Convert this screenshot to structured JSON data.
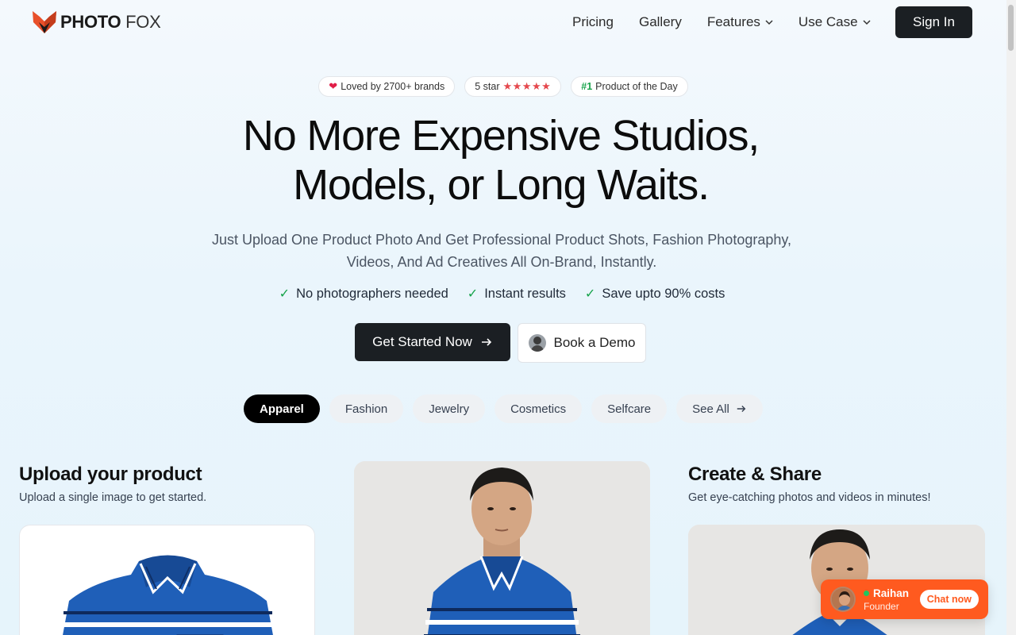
{
  "brand": {
    "bold": "PHOTO",
    "light": "FOX"
  },
  "nav": {
    "links": [
      {
        "label": "Pricing"
      },
      {
        "label": "Gallery"
      },
      {
        "label": "Features"
      },
      {
        "label": "Use Case"
      }
    ],
    "signin": "Sign In"
  },
  "badges": {
    "loved": "Loved by 2700+ brands",
    "rating_label": "5 star",
    "rating_stars": "★★★★★",
    "rating_value": 5,
    "pod_number": "#1",
    "pod_label": "Product of the Day"
  },
  "hero": {
    "title_line1": "No More Expensive Studios,",
    "title_line2": "Models, or Long Waits.",
    "subtitle": "Just Upload One Product Photo And Get Professional Product Shots, Fashion Photography, Videos, And Ad Creatives All On-Brand, Instantly.",
    "checks": [
      "No photographers needed",
      "Instant results",
      "Save upto 90% costs"
    ],
    "cta_primary": "Get Started Now",
    "cta_secondary": "Book a Demo"
  },
  "categories": {
    "items": [
      "Apparel",
      "Fashion",
      "Jewelry",
      "Cosmetics",
      "Selfcare"
    ],
    "active": "Apparel",
    "see_all": "See All"
  },
  "steps": {
    "upload_title": "Upload your product",
    "upload_sub": "Upload a single image to get started.",
    "create_title": "Create & Share",
    "create_sub": "Get eye-catching photos and videos in minutes!"
  },
  "chat": {
    "name": "Raihan",
    "role": "Founder",
    "button": "Chat now"
  },
  "colors": {
    "accent": "#ff5a1f",
    "dark": "#1b1f23",
    "success": "#16a34a",
    "star": "#e5484d",
    "shirt_blue": "#1f5fb8"
  }
}
